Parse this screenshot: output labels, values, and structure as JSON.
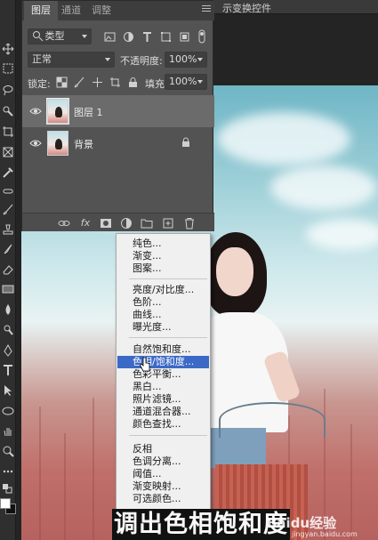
{
  "topbar": {
    "transform_label": "示变换控件"
  },
  "layers_panel": {
    "tabs": [
      {
        "label": "图层",
        "active": true
      },
      {
        "label": "通道",
        "active": false
      },
      {
        "label": "调整",
        "active": false
      }
    ],
    "filter_kind": "类型",
    "blend_mode": "正常",
    "opacity_label": "不透明度:",
    "opacity_value": "100%",
    "lock_label": "锁定:",
    "fill_label": "填充:",
    "fill_value": "100%",
    "layers": [
      {
        "name": "图层 1",
        "visible": true,
        "selected": true,
        "locked": false
      },
      {
        "name": "背景",
        "visible": true,
        "selected": false,
        "locked": true
      }
    ],
    "footer_buttons": [
      "link-icon",
      "fx",
      "mask-icon",
      "adjustment-layer-icon",
      "folder-icon",
      "new-layer-icon",
      "trash-icon"
    ]
  },
  "adjustment_menu": {
    "groups": [
      [
        "纯色...",
        "渐变...",
        "图案..."
      ],
      [
        "亮度/对比度...",
        "色阶...",
        "曲线...",
        "曝光度..."
      ],
      [
        "自然饱和度...",
        "色相/饱和度...",
        "色彩平衡...",
        "黑白...",
        "照片滤镜...",
        "通道混合器...",
        "颜色查找..."
      ],
      [
        "反相",
        "色调分离...",
        "阈值...",
        "渐变映射...",
        "可选颜色..."
      ]
    ],
    "highlighted": "色相/饱和度..."
  },
  "caption": "调出色相饱和度",
  "watermark": {
    "brand": "Baidu经验",
    "sub": "jingyan.baidu.com"
  },
  "colors": {
    "highlight": "#3b69c6",
    "panel": "#535353",
    "menu_bg": "#f0f0f0"
  }
}
